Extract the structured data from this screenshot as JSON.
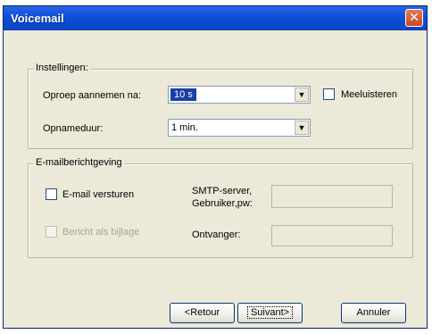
{
  "window": {
    "title": "Voicemail",
    "close_glyph": "✕"
  },
  "instellingen": {
    "legend": "Instellingen:",
    "oproep_label": "Oproep aannemen na:",
    "oproep_value": "10 s",
    "meeluisteren_label": "Meeluisteren",
    "meeluisteren_checked": false,
    "opname_label": "Opnameduur:",
    "opname_value": "1 min."
  },
  "email": {
    "legend": "E-mailberichtgeving",
    "versturen_label": "E-mail versturen",
    "versturen_checked": false,
    "bijlage_label": "Bericht als bijlage",
    "bijlage_checked": false,
    "smtp_label": "SMTP-server,",
    "gebruiker_label": "Gebruiker,pw:",
    "smtp_value": "",
    "ontvanger_label": "Ontvanger:",
    "ontvanger_value": ""
  },
  "buttons": {
    "back": "<Retour",
    "next": "Suivant>",
    "cancel": "Annuler"
  },
  "icons": {
    "dropdown": "chevron-down-icon",
    "close": "close-icon"
  }
}
